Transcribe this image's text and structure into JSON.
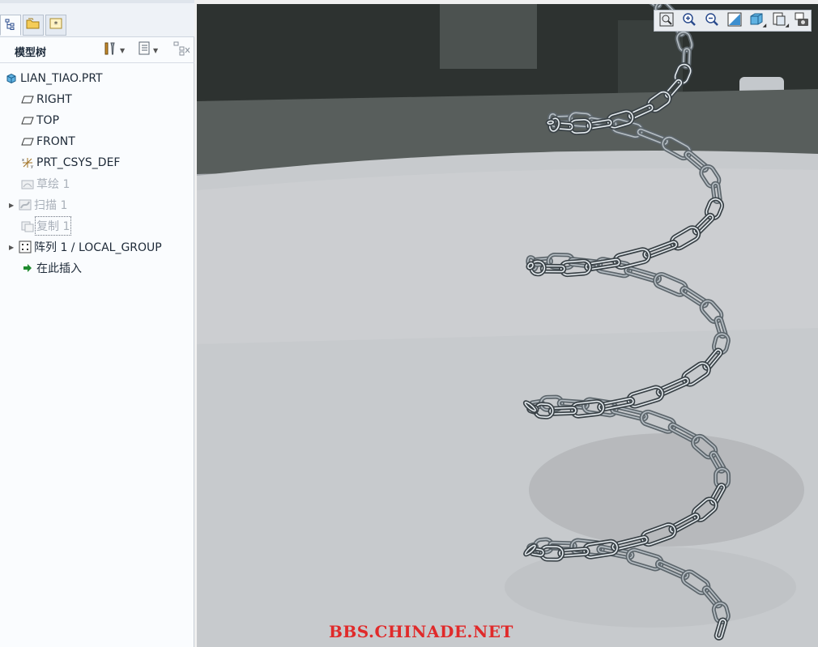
{
  "model_tree": {
    "title": "模型树",
    "tabs": [
      {
        "name": "model-tree-tab",
        "icon": "tree-structure-icon",
        "active": true
      },
      {
        "name": "folder-browser-tab",
        "icon": "folder-icon",
        "active": false
      },
      {
        "name": "favorites-tab",
        "icon": "star-icon",
        "active": false
      }
    ],
    "header_buttons": [
      "settings-tools-icon",
      "show-list-icon",
      "filter-icon"
    ],
    "items": [
      {
        "label": "LIAN_TIAO.PRT",
        "icon": "part-icon",
        "indent": 0,
        "expander": false,
        "dim": false,
        "boxed": false
      },
      {
        "label": "RIGHT",
        "icon": "datum-plane-icon",
        "indent": 1,
        "expander": false,
        "dim": false,
        "boxed": false
      },
      {
        "label": "TOP",
        "icon": "datum-plane-icon",
        "indent": 1,
        "expander": false,
        "dim": false,
        "boxed": false
      },
      {
        "label": "FRONT",
        "icon": "datum-plane-icon",
        "indent": 1,
        "expander": false,
        "dim": false,
        "boxed": false
      },
      {
        "label": "PRT_CSYS_DEF",
        "icon": "coordinate-system-icon",
        "indent": 1,
        "expander": false,
        "dim": false,
        "boxed": false
      },
      {
        "label": "草绘 1",
        "icon": "sketch-icon",
        "indent": 1,
        "expander": false,
        "dim": true,
        "boxed": false
      },
      {
        "label": "扫描 1",
        "icon": "sweep-icon",
        "indent": 1,
        "expander": true,
        "dim": true,
        "boxed": false
      },
      {
        "label": "复制 1",
        "icon": "copy-icon",
        "indent": 1,
        "expander": false,
        "dim": true,
        "boxed": true
      },
      {
        "label": "阵列 1 / LOCAL_GROUP",
        "icon": "pattern-icon",
        "indent": 1,
        "expander": true,
        "dim": false,
        "boxed": false
      },
      {
        "label": "在此插入",
        "icon": "insert-here-arrow-icon",
        "indent": 1,
        "expander": false,
        "dim": false,
        "boxed": false
      }
    ]
  },
  "view_toolbar": {
    "buttons": [
      {
        "name": "refit-button",
        "icon": "zoom-fit-icon"
      },
      {
        "name": "zoom-in-button",
        "icon": "zoom-in-icon"
      },
      {
        "name": "zoom-out-button",
        "icon": "zoom-out-icon"
      },
      {
        "name": "repaint-button",
        "icon": "repaint-icon"
      },
      {
        "name": "display-style-button",
        "icon": "display-style-icon",
        "dropdown": true
      },
      {
        "name": "saved-views-button",
        "icon": "saved-views-icon",
        "dropdown": true
      },
      {
        "name": "screenshot-button",
        "icon": "camera-icon"
      }
    ]
  },
  "viewport": {
    "watermark": "BBS.CHINADE.NET"
  },
  "colors": {
    "panel_bg": "#fafcfe",
    "chain_metal": "#a8b0b6",
    "watermark": "#e02a2a",
    "insert_arrow": "#1e8a2e"
  }
}
